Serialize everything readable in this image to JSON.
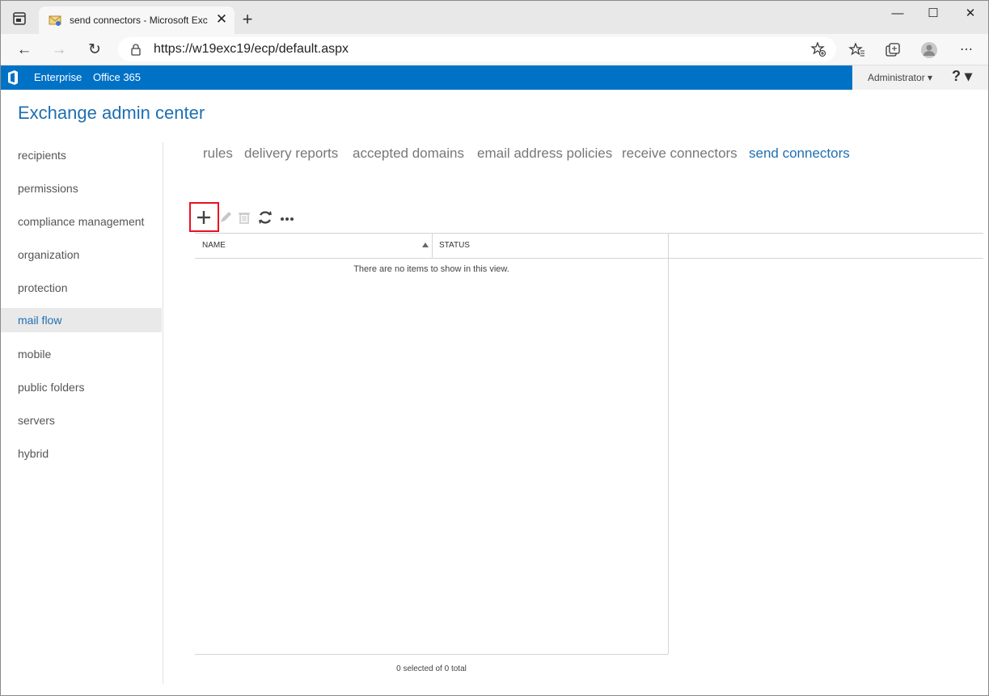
{
  "browser": {
    "tab_title": "send connectors - Microsoft Exc…",
    "url": "https://w19exc19/ecp/default.aspx"
  },
  "o365": {
    "enterprise": "Enterprise",
    "office365": "Office 365",
    "user": "Administrator ▾",
    "help": "? ▾"
  },
  "app": {
    "title": "Exchange admin center"
  },
  "leftnav": {
    "items": [
      {
        "label": "recipients"
      },
      {
        "label": "permissions"
      },
      {
        "label": "compliance management"
      },
      {
        "label": "organization"
      },
      {
        "label": "protection"
      },
      {
        "label": "mail flow",
        "selected": true
      },
      {
        "label": "mobile"
      },
      {
        "label": "public folders"
      },
      {
        "label": "servers"
      },
      {
        "label": "hybrid"
      }
    ]
  },
  "subtabs": [
    {
      "label": "rules"
    },
    {
      "label": "delivery reports"
    },
    {
      "label": "accepted domains"
    },
    {
      "label": "email address policies"
    },
    {
      "label": "receive connectors"
    },
    {
      "label": "send connectors",
      "active": true
    }
  ],
  "grid": {
    "col_name": "NAME",
    "col_status": "STATUS",
    "empty_message": "There are no items to show in this view.",
    "footer": "0 selected of 0 total"
  },
  "colors": {
    "accent": "#0072c6",
    "title": "#1f6fb2",
    "highlight_box": "#e81123"
  }
}
